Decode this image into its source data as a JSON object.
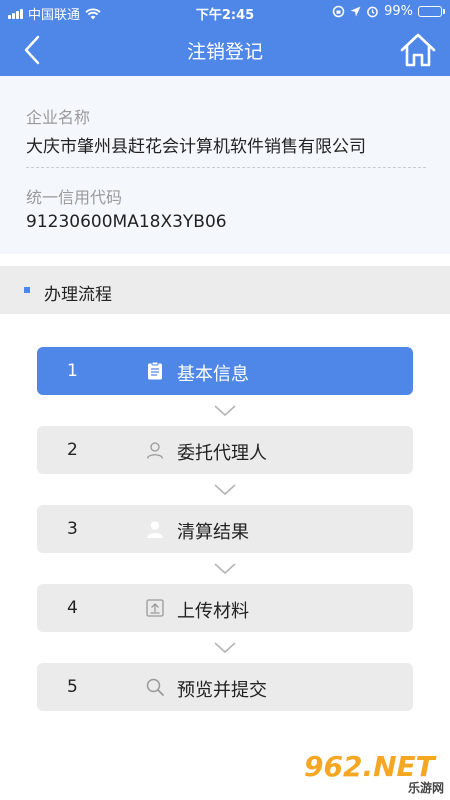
{
  "status_bar": {
    "carrier": "中国联通",
    "time": "下午2:45",
    "battery": "99%",
    "battery_level": 0.99
  },
  "nav": {
    "title": "注销登记",
    "back_icon": "chevron-left-icon",
    "home_icon": "home-icon"
  },
  "company": {
    "name_label": "企业名称",
    "name_value": "大庆市肇州县赶花会计算机软件销售有限公司",
    "code_label": "统一信用代码",
    "code_value": "91230600MA18X3YB06"
  },
  "section": {
    "title": "办理流程"
  },
  "steps": [
    {
      "num": "1",
      "label": "基本信息",
      "icon": "clipboard-icon",
      "active": true
    },
    {
      "num": "2",
      "label": "委托代理人",
      "icon": "person-outline-icon",
      "active": false
    },
    {
      "num": "3",
      "label": "清算结果",
      "icon": "person-filled-icon",
      "active": false
    },
    {
      "num": "4",
      "label": "上传材料",
      "icon": "upload-icon",
      "active": false
    },
    {
      "num": "5",
      "label": "预览并提交",
      "icon": "search-icon",
      "active": false
    }
  ],
  "watermark": {
    "brand": "962.NET",
    "sub": "乐游网"
  },
  "colors": {
    "primary": "#4f87e8",
    "step_bg": "#ebebeb",
    "info_bg": "#f4f8fc"
  }
}
